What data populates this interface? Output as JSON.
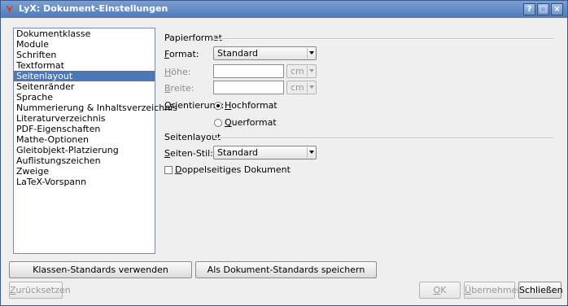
{
  "window": {
    "title": "LyX: Dokument-Einstellungen",
    "title_buttons": {
      "help": "?",
      "maximize": "□",
      "close": "×"
    }
  },
  "sidebar": {
    "items": [
      {
        "label": "Dokumentklasse",
        "selected": false
      },
      {
        "label": "Module",
        "selected": false
      },
      {
        "label": "Schriften",
        "selected": false
      },
      {
        "label": "Textformat",
        "selected": false
      },
      {
        "label": "Seitenlayout",
        "selected": true
      },
      {
        "label": "Seitenränder",
        "selected": false
      },
      {
        "label": "Sprache",
        "selected": false
      },
      {
        "label": "Nummerierung & Inhaltsverzeichnis",
        "selected": false
      },
      {
        "label": "Literaturverzeichnis",
        "selected": false
      },
      {
        "label": "PDF-Eigenschaften",
        "selected": false
      },
      {
        "label": "Mathe-Optionen",
        "selected": false
      },
      {
        "label": "Gleitobjekt-Platzierung",
        "selected": false
      },
      {
        "label": "Auflistungszeichen",
        "selected": false
      },
      {
        "label": "Zweige",
        "selected": false
      },
      {
        "label": "LaTeX-Vorspann",
        "selected": false
      }
    ]
  },
  "papierformat": {
    "section_title": "Papierformat",
    "format": {
      "key": "F",
      "rest": "ormat:",
      "value": "Standard"
    },
    "hoehe": {
      "key": "H",
      "rest": "öhe:",
      "value": "",
      "unit": "cm"
    },
    "breite": {
      "key": "B",
      "rest": "reite:",
      "value": "",
      "unit": "cm"
    },
    "orientierung": {
      "key": "O",
      "rest": "rientierung:",
      "hochformat": {
        "key": "H",
        "rest": "ochformat",
        "checked": true
      },
      "querformat": {
        "key": "Q",
        "rest": "uerformat",
        "checked": false
      }
    }
  },
  "seitenlayout": {
    "section_title": "Seitenlayout",
    "seiten_stil": {
      "key": "S",
      "rest": "eiten-Stil:",
      "value": "Standard"
    },
    "doppelseitig": {
      "key": "D",
      "rest": "oppelseitiges Dokument",
      "checked": false
    }
  },
  "buttons": {
    "klassen_standards": "Klassen-Standards verwenden",
    "als_standards": "Als Dokument-Standards speichern",
    "zuruecksetzen": {
      "key": "Z",
      "rest": "urücksetzen"
    },
    "ok": {
      "key": "O",
      "rest": "K"
    },
    "uebernehmen": {
      "key": "Ü",
      "rest": "bernehmen"
    },
    "schliessen": "Schließen"
  }
}
